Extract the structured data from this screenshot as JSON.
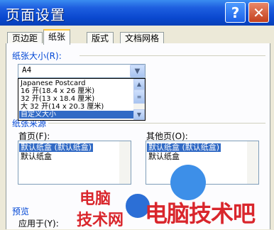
{
  "window": {
    "title": "页面设置",
    "help_glyph": "?",
    "close_glyph": "✕"
  },
  "tabs": [
    {
      "label": "页边距"
    },
    {
      "label": "纸张"
    },
    {
      "label": "版式"
    },
    {
      "label": "文档网格"
    }
  ],
  "paper_size": {
    "group_label": "纸张大小(R):",
    "selected_value": "A4",
    "options": [
      "Japanese Postcard",
      "16 开(18.4 x 26 厘米)",
      "32 开(13 x 18.4 厘米)",
      "大 32 开(14 x 20.3 厘米)",
      "自定义大小"
    ],
    "highlighted_option": "自定义大小"
  },
  "paper_source": {
    "group_label": "纸张来源",
    "first_page_label": "首页(F):",
    "first_page_items": [
      "默认纸盒 (默认纸盒)",
      "默认纸盒"
    ],
    "other_pages_label": "其他页(O):",
    "other_pages_items": [
      "默认纸盒 (默认纸盒)",
      "默认纸盒"
    ]
  },
  "preview": {
    "group_label": "预览",
    "apply_to_label": "应用于(Y):"
  },
  "watermark": {
    "line1": "电脑",
    "line2": "技术网",
    "brand": "电脑技术吧"
  }
}
